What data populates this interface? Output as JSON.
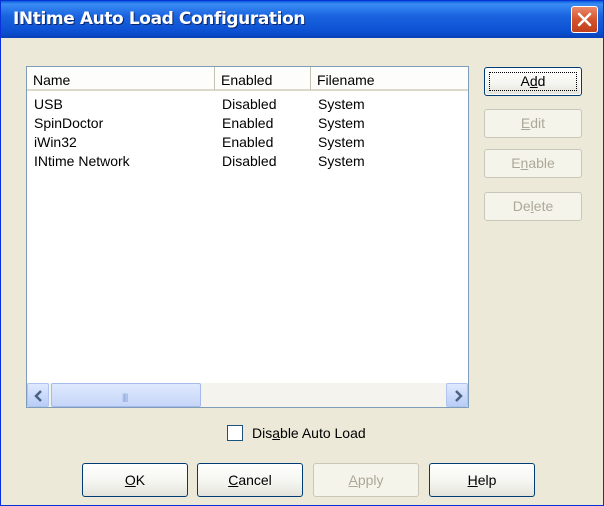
{
  "window": {
    "title": "INtime Auto Load Configuration"
  },
  "list": {
    "columns": [
      "Name",
      "Enabled",
      "Filename"
    ],
    "rows": [
      {
        "name": "USB",
        "enabled": "Disabled",
        "filename": "System"
      },
      {
        "name": "SpinDoctor",
        "enabled": "Enabled",
        "filename": "System"
      },
      {
        "name": "iWin32",
        "enabled": "Enabled",
        "filename": "System"
      },
      {
        "name": "INtime Network",
        "enabled": "Disabled",
        "filename": "System"
      }
    ]
  },
  "side_buttons": {
    "add": {
      "pre": "A",
      "key": "d",
      "post": "d"
    },
    "edit": {
      "pre": "",
      "key": "E",
      "post": "dit"
    },
    "enable": {
      "pre": "E",
      "key": "n",
      "post": "able"
    },
    "delete": {
      "pre": "De",
      "key": "l",
      "post": "ete"
    }
  },
  "checkbox": {
    "pre": "Dis",
    "key": "a",
    "post": "ble Auto Load",
    "checked": false
  },
  "bottom_buttons": {
    "ok": {
      "pre": "",
      "key": "O",
      "post": "K"
    },
    "cancel": {
      "pre": "",
      "key": "C",
      "post": "ancel"
    },
    "apply": {
      "pre": "",
      "key": "A",
      "post": "pply"
    },
    "help": {
      "pre": "",
      "key": "H",
      "post": "elp"
    }
  },
  "colors": {
    "titlebar": "#0a5fd8",
    "close": "#d4542c",
    "face": "#ece9d8"
  }
}
